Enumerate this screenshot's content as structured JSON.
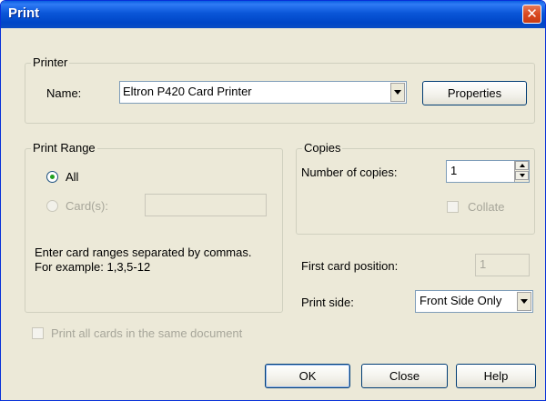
{
  "window": {
    "title": "Print",
    "close_glyph": "✕"
  },
  "printer": {
    "legend": "Printer",
    "name_label": "Name:",
    "selected_printer": "Eltron P420 Card Printer",
    "properties_label": "Properties"
  },
  "print_range": {
    "legend": "Print Range",
    "all_label": "All",
    "cards_label": "Card(s):",
    "cards_value": "",
    "hint_line1": "Enter card ranges separated by commas.",
    "hint_line2": "For example: 1,3,5-12"
  },
  "copies": {
    "legend": "Copies",
    "number_label": "Number of copies:",
    "number_value": "1",
    "collate_label": "Collate"
  },
  "first_card": {
    "label": "First card position:",
    "value": "1"
  },
  "print_side": {
    "label": "Print side:",
    "selected": "Front Side Only"
  },
  "same_document_label": "Print all cards in the same document",
  "buttons": {
    "ok": "OK",
    "close": "Close",
    "help": "Help"
  },
  "colors": {
    "title_bar": "#0a56d8",
    "dialog_bg": "#ece9d8",
    "close_button": "#d94a20"
  }
}
